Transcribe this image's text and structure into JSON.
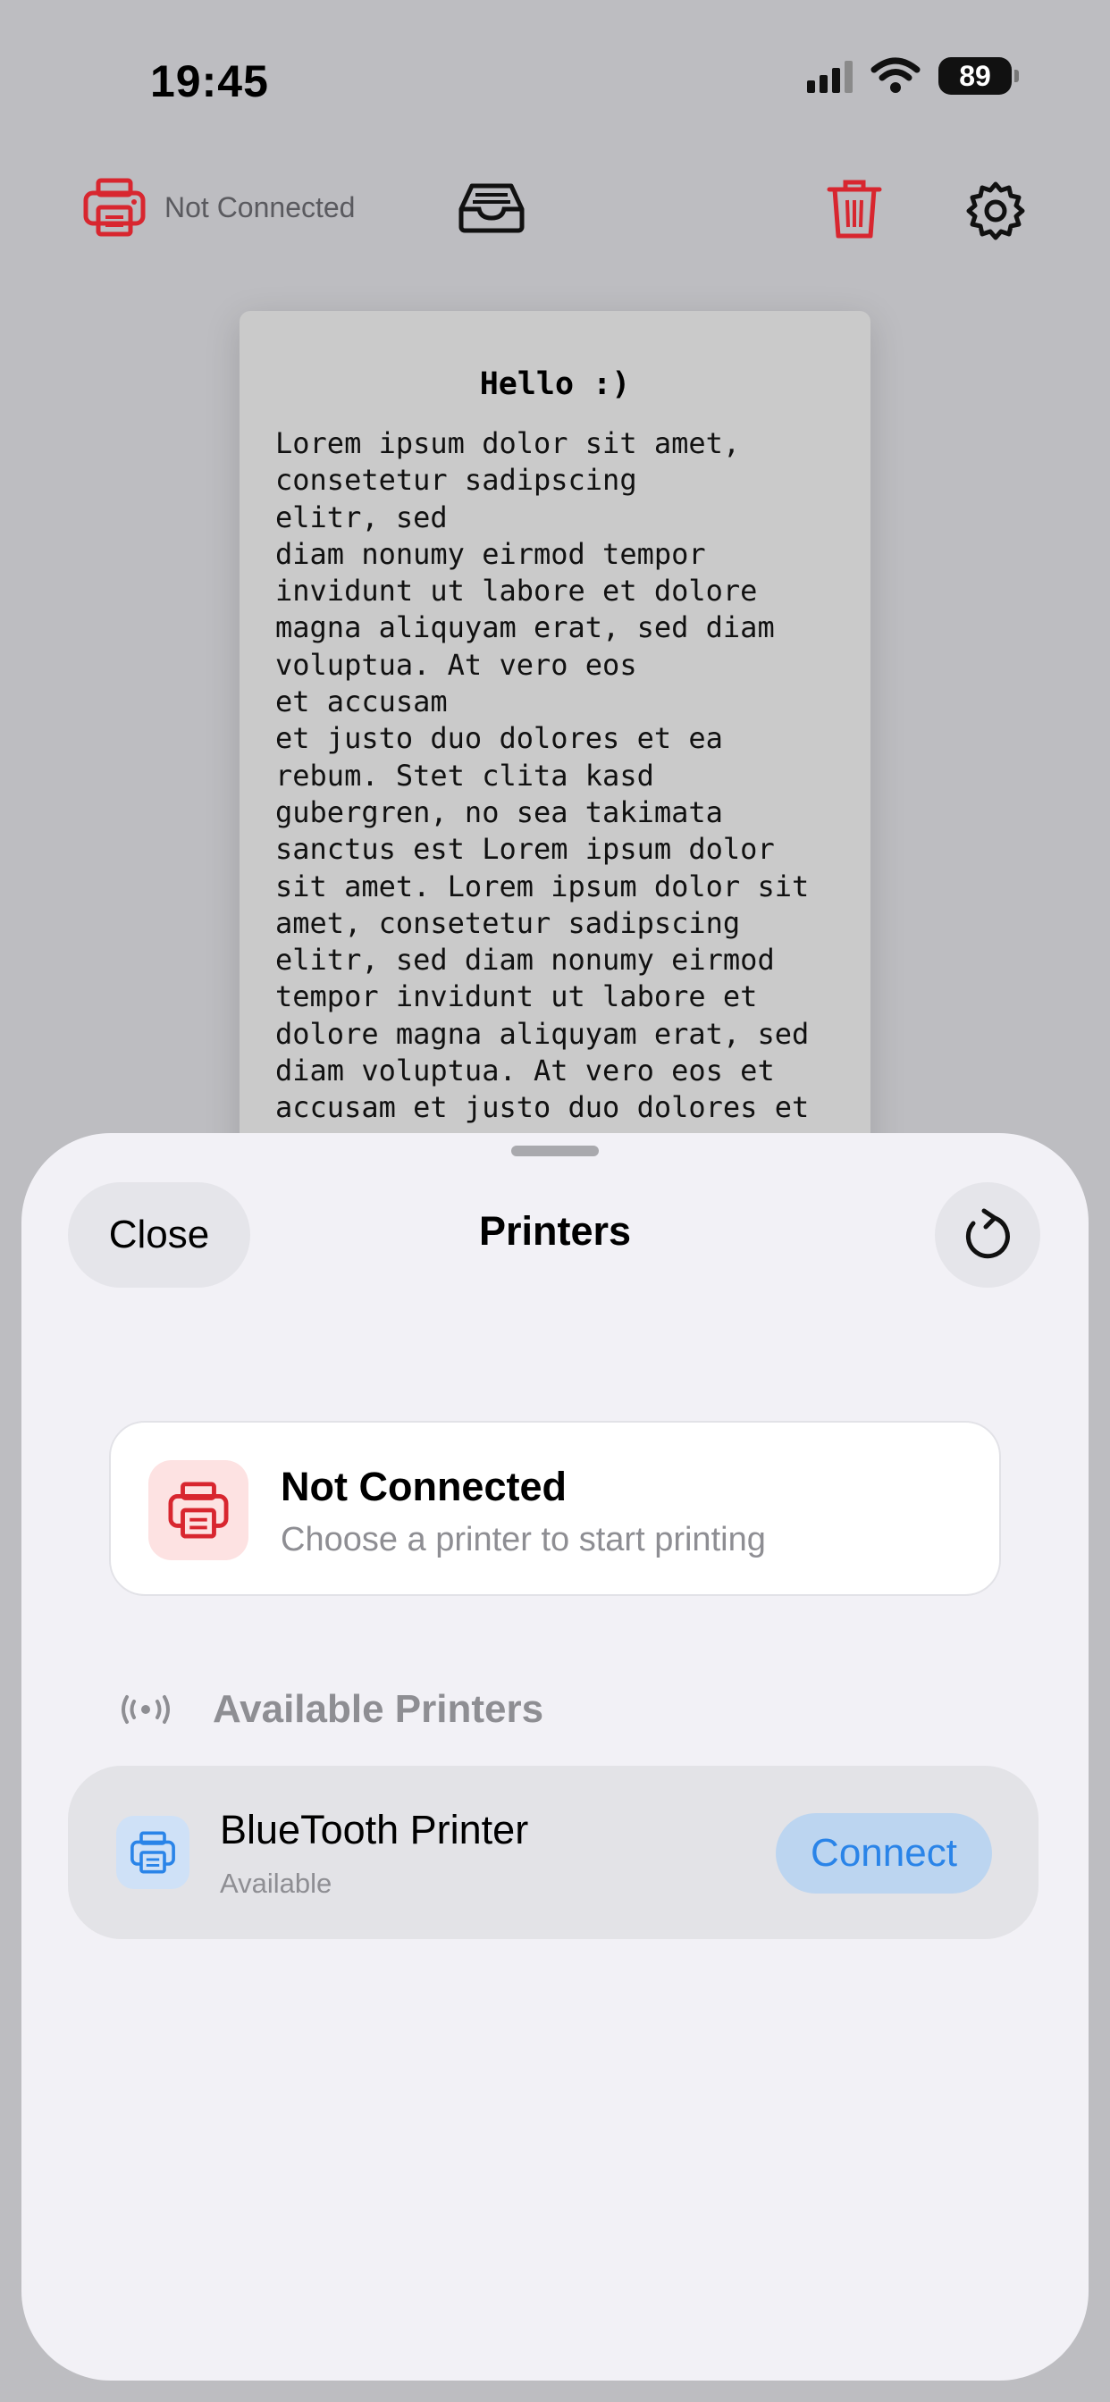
{
  "status_bar": {
    "time": "19:45",
    "battery": "89"
  },
  "toolbar": {
    "printer_status": "Not Connected",
    "printer_icon": "printer-icon",
    "inbox_icon": "tray-icon",
    "trash_icon": "trash-icon",
    "settings_icon": "gear-icon",
    "accent_red": "#d8262f"
  },
  "paper": {
    "title": "Hello :)",
    "lines": [
      "Lorem ipsum dolor sit amet,",
      "consetetur sadipscing",
      "elitr, sed",
      "diam nonumy eirmod tempor",
      "invidunt ut labore et dolore",
      "magna aliquyam erat, sed diam",
      "voluptua. At vero eos",
      "et accusam",
      "et justo duo dolores et ea",
      "rebum. Stet clita kasd",
      "gubergren, no sea takimata",
      "sanctus est Lorem ipsum dolor",
      "sit amet. Lorem ipsum dolor sit",
      "amet, consetetur sadipscing",
      "elitr, sed diam nonumy eirmod",
      "tempor invidunt ut labore et",
      "dolore magna aliquyam erat, sed",
      "diam voluptua. At vero eos et",
      "accusam et justo duo dolores et"
    ]
  },
  "sheet": {
    "close_label": "Close",
    "title": "Printers",
    "refresh_icon": "refresh-icon",
    "status_card": {
      "title": "Not Connected",
      "subtitle": "Choose a printer to start printing"
    },
    "section_title": "Available Printers",
    "section_icon": "antenna-icon",
    "printers": [
      {
        "name": "BlueTooth Printer",
        "status": "Available",
        "action": "Connect"
      }
    ],
    "accent_blue": "#2a84e8"
  }
}
